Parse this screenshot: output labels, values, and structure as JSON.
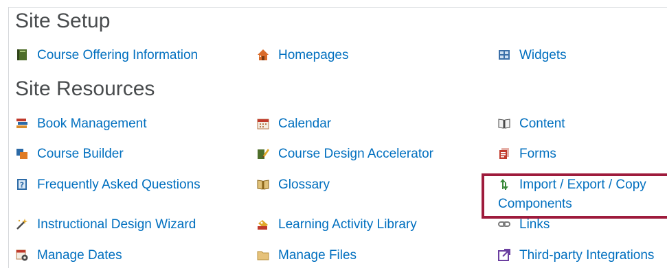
{
  "site_setup": {
    "heading": "Site Setup",
    "tools": [
      {
        "label": "Course Offering Information",
        "icon": "book-icon"
      },
      {
        "label": "Homepages",
        "icon": "home-icon"
      },
      {
        "label": "Widgets",
        "icon": "widgets-icon"
      }
    ]
  },
  "site_resources": {
    "heading": "Site Resources",
    "tools": [
      {
        "label": "Book Management",
        "icon": "book-stack-icon"
      },
      {
        "label": "Calendar",
        "icon": "calendar-icon"
      },
      {
        "label": "Content",
        "icon": "open-book-icon"
      },
      {
        "label": "Course Builder",
        "icon": "course-builder-icon"
      },
      {
        "label": "Course Design Accelerator",
        "icon": "design-accelerator-icon"
      },
      {
        "label": "Forms",
        "icon": "forms-icon"
      },
      {
        "label": "Frequently Asked Questions",
        "icon": "faq-icon"
      },
      {
        "label": "Glossary",
        "icon": "glossary-icon"
      },
      {
        "label_line1": "Import / Export / Copy",
        "label_line2": "Components",
        "icon": "import-export-icon"
      },
      {
        "label": "Instructional Design Wizard",
        "icon": "wand-icon"
      },
      {
        "label": "Learning Activity Library",
        "icon": "activity-library-icon"
      },
      {
        "label": "Links",
        "icon": "link-icon"
      },
      {
        "label": "Manage Dates",
        "icon": "manage-dates-icon"
      },
      {
        "label": "Manage Files",
        "icon": "folder-icon"
      },
      {
        "label": "Third-party Integrations",
        "icon": "integrations-icon"
      }
    ]
  },
  "colors": {
    "link": "#006fbf",
    "heading": "#494c4e",
    "highlight_border": "#9e1b3c"
  }
}
